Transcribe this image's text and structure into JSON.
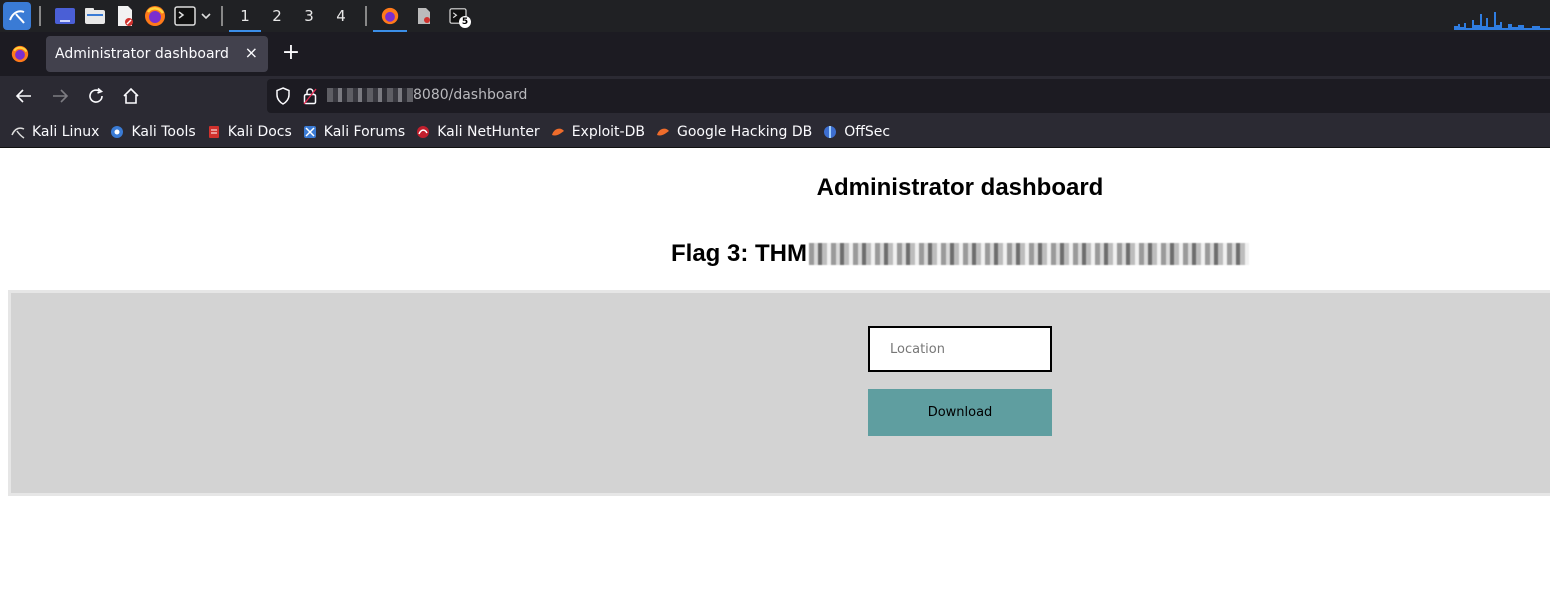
{
  "taskbar": {
    "workspaces": [
      "1",
      "2",
      "3",
      "4"
    ],
    "terminal_badge": "5"
  },
  "browser": {
    "tab_title": "Administrator dashboard",
    "tab_close": "×",
    "new_tab": "+",
    "url_visible": "8080/dashboard"
  },
  "bookmarks": [
    {
      "label": "Kali Linux",
      "icon": "kali-dragon-icon"
    },
    {
      "label": "Kali Tools",
      "icon": "kali-tools-icon"
    },
    {
      "label": "Kali Docs",
      "icon": "kali-docs-icon"
    },
    {
      "label": "Kali Forums",
      "icon": "kali-forums-icon"
    },
    {
      "label": "Kali NetHunter",
      "icon": "kali-nethunter-icon"
    },
    {
      "label": "Exploit-DB",
      "icon": "exploit-db-icon"
    },
    {
      "label": "Google Hacking DB",
      "icon": "ghdb-icon"
    },
    {
      "label": "OffSec",
      "icon": "offsec-icon"
    }
  ],
  "page": {
    "title": "Administrator dashboard",
    "flag_label": "Flag 3: THM",
    "location_placeholder": "Location",
    "download_label": "Download"
  },
  "colors": {
    "panel": "#d3d3d3",
    "download_button": "#5f9ea0",
    "accent": "#3b8ee8"
  }
}
